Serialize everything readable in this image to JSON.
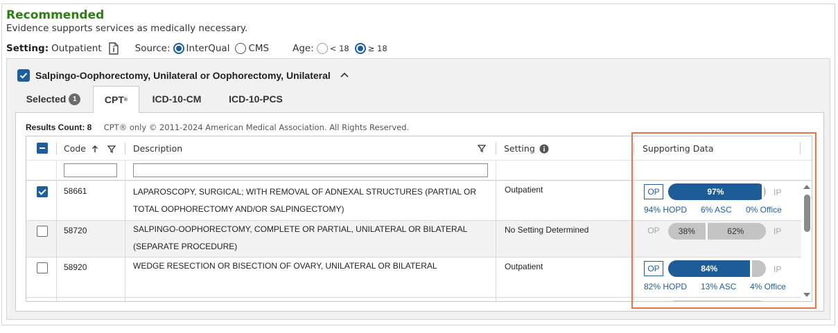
{
  "recommendation": {
    "title": "Recommended",
    "subtitle": "Evidence supports services as medically necessary."
  },
  "setting_bar": {
    "setting_label": "Setting:",
    "setting_value": "Outpatient",
    "source_label": "Source:",
    "source_options": [
      {
        "label": "InterQual",
        "selected": true
      },
      {
        "label": "CMS",
        "selected": false
      }
    ],
    "age_label": "Age:",
    "age_options": [
      {
        "label": "< 18",
        "selected": false
      },
      {
        "label": "≥ 18",
        "selected": true
      }
    ]
  },
  "procedure": {
    "checked": true,
    "title": "Salpingo-Oophorectomy, Unilateral or Oophorectomy, Unilateral"
  },
  "tabs": {
    "selected_label": "Selected",
    "selected_count": "1",
    "cpt_label": "CPT",
    "cpt_mark": "®",
    "icd10cm_label": "ICD-10-CM",
    "icd10pcs_label": "ICD-10-PCS",
    "active": "CPT"
  },
  "results": {
    "count_label": "Results Count: 8",
    "copyright": "CPT® only © 2011-2024 American Medical Association. All Rights Reserved."
  },
  "table": {
    "columns": {
      "code": "Code",
      "description": "Description",
      "setting": "Setting",
      "supporting": "Supporting Data"
    },
    "rows": [
      {
        "checked": true,
        "code": "58661",
        "description_line1": "LAPAROSCOPY, SURGICAL; WITH REMOVAL OF ADNEXAL STRUCTURES (PARTIAL OR",
        "description_line2": "TOTAL OOPHORECTOMY AND/OR SALPINGECTOMY)",
        "setting": "Outpatient",
        "op_label": "OP",
        "ip_label": "IP",
        "op_pct": 97,
        "op_pct_label": "97%",
        "hopd": "94% HOPD",
        "asc": "6% ASC",
        "office": "0% Office"
      },
      {
        "checked": false,
        "code": "58720",
        "description_line1": "SALPINGO-OOPHORECTOMY, COMPLETE OR PARTIAL, UNILATERAL OR BILATERAL",
        "description_line2": "(SEPARATE PROCEDURE)",
        "setting": "No Setting Determined",
        "op_label": "OP",
        "ip_label": "IP",
        "op_pct": 38,
        "op_pct_label": "38%",
        "ip_pct_label": "62%"
      },
      {
        "checked": false,
        "code": "58920",
        "description_line1": "WEDGE RESECTION OR BISECTION OF OVARY, UNILATERAL OR BILATERAL",
        "setting": "Outpatient",
        "op_label": "OP",
        "ip_label": "IP",
        "op_pct": 84,
        "op_pct_label": "84%",
        "hopd": "82% HOPD",
        "asc": "13% ASC",
        "office": "4% Office"
      }
    ]
  },
  "colors": {
    "recommended_green": "#2e7d17",
    "primary_blue": "#1d5c96",
    "highlight_orange": "#e8734a"
  }
}
